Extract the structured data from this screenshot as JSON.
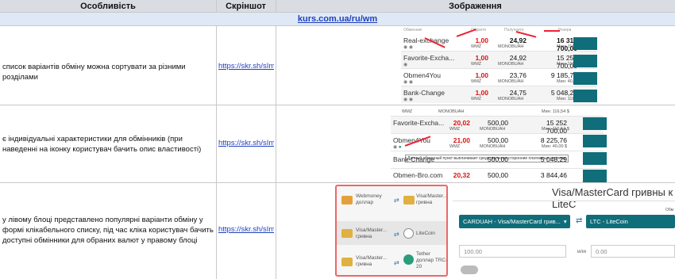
{
  "header": {
    "col1": "Особливість",
    "col2": "Скріншот",
    "col3": "Зображення"
  },
  "site_link": "kurs.com.ua/ru/wm",
  "rows": [
    {
      "feature": "список варіантів обміну можна сортувати за різними розділами",
      "link": "https://skr.sh/sImx"
    },
    {
      "feature": "є індивідуальні характеристики для обмінників (при наведенні на іконку користувач бачить опис властивості)",
      "link": "https://skr.sh/sImv"
    },
    {
      "feature": "у лівому блоці представлено популярні варіанти обміну у формі клікабельного списку, під час кліка користувач бачить доступні обмінники для обраних валют у правому блоці",
      "link": "https://skr.sh/sImv"
    }
  ],
  "shot1": {
    "headers": [
      "Обменник",
      "Отдаете",
      "Получаете",
      "Резерв"
    ],
    "rows": [
      {
        "name": "Real-exchange",
        "give": "1,00",
        "give_sub": "WMZ",
        "get": "24,92",
        "get_sub": "MONOBUAH",
        "reserve": "16 312 700,00",
        "reserve_sub": "Мин: 116,54 $"
      },
      {
        "name": "Favorite-Excha...",
        "give": "1,00",
        "give_sub": "WMZ",
        "get": "24,92",
        "get_sub": "MONOBUAH",
        "reserve": "15 252 700,00",
        "reserve_sub": "Мин: 116,54 $"
      },
      {
        "name": "Obmen4You",
        "give": "1,00",
        "give_sub": "WMZ",
        "get": "23,76",
        "get_sub": "MONOBUAH",
        "reserve": "9 185,76",
        "reserve_sub": "Мин: 40,00 $"
      },
      {
        "name": "Bank-Change",
        "give": "1,00",
        "give_sub": "WMZ",
        "get": "24,75",
        "get_sub": "MONOBUAH",
        "reserve": "5 048,29",
        "reserve_sub": "Мин: 116,54 $"
      }
    ]
  },
  "shot2": {
    "rows": [
      {
        "name": "",
        "give": "",
        "give_sub": "WMZ",
        "get": "",
        "get_sub": "MONOBUAH",
        "reserve": "",
        "reserve_sub": "Мин: 116,54 $"
      },
      {
        "name": "Favorite-Excha...",
        "give": "20,02",
        "give_sub": "WMZ",
        "get": "500,00",
        "get_sub": "MONOBUAH",
        "reserve": "15 252 700,00",
        "reserve_sub": "Мин: 116,54 $"
      },
      {
        "name": "Obmen4You",
        "give": "21,00",
        "give_sub": "WMZ",
        "get": "500,00",
        "get_sub": "MONOBUAH",
        "reserve": "8 225,76",
        "reserve_sub": "Мин: 40,00 $"
      },
      {
        "name": "Bank-Change",
        "give": "",
        "give_sub": "",
        "get": "500,00",
        "get_sub": "MONOBUAH",
        "reserve": "5 048,29",
        "reserve_sub": ""
      },
      {
        "name": "Obmen-Bro.com",
        "give": "20,32",
        "give_sub": "",
        "get": "500,00",
        "get_sub": "",
        "reserve": "3 844,46",
        "reserve_sub": ""
      }
    ],
    "tooltip": "Данный обменный пункт выплачивает средства через сторонние платежные системы"
  },
  "shot3": {
    "popular": [
      {
        "from": "Webmoney доллар",
        "to": "Visa/Master... гривна"
      },
      {
        "from": "Visa/Master... гривна",
        "to": "LiteCoin"
      },
      {
        "from": "Visa/Master... гривна",
        "to": "Tether доллар TRC-20"
      }
    ],
    "title": "Visa/MasterCard гривны к LiteC",
    "select_from": "CARDUAH - Visa/MasterCard грив...",
    "select_to": "LTC - LiteCoin",
    "amount_from": "100.00",
    "amount_to": "0.00",
    "or_label": "или",
    "corner_label": "Обм"
  }
}
